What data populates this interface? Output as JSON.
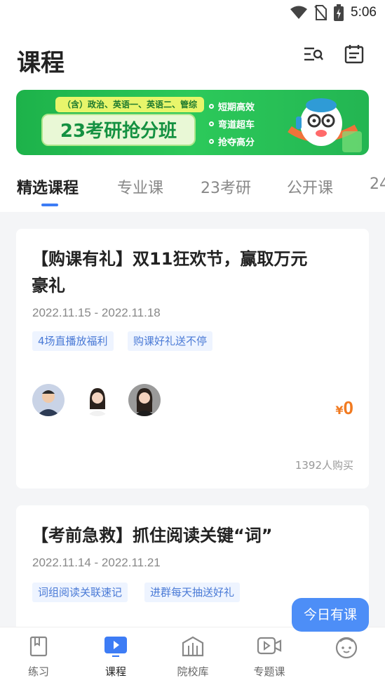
{
  "status_bar": {
    "time": "5:06"
  },
  "header": {
    "title": "课程"
  },
  "banner": {
    "subjects": "（含）政治、英语一、英语二、管综",
    "title": "23考研抢分班",
    "points": [
      "短期高效",
      "弯道超车",
      "抢夺高分"
    ]
  },
  "tabs": [
    {
      "label": "精选课程"
    },
    {
      "label": "专业课"
    },
    {
      "label": "23考研"
    },
    {
      "label": "公开课"
    },
    {
      "label": "24"
    }
  ],
  "courses": [
    {
      "title_line1": "【购课有礼】双11狂欢节，赢取万元",
      "title_line2": "豪礼",
      "date": "2022.11.15 - 2022.11.18",
      "tags": [
        "4场直播放福利",
        "购课好礼送不停"
      ],
      "price_symbol": "¥",
      "price": "0",
      "buyers": "1392人购买"
    },
    {
      "title_line1": "【考前急救】抓住阅读关键“词”",
      "date": "2022.11.14 - 2022.11.21",
      "tags": [
        "词组阅读关联速记",
        "进群每天抽送好礼"
      ]
    }
  ],
  "floating": {
    "today": "今日有课"
  },
  "bottom_nav": [
    {
      "label": "练习",
      "icon": "book-icon"
    },
    {
      "label": "课程",
      "icon": "play-icon"
    },
    {
      "label": "院校库",
      "icon": "building-icon"
    },
    {
      "label": "专题课",
      "icon": "video-icon"
    },
    {
      "label": "",
      "icon": "face-icon"
    }
  ],
  "colors": {
    "accent": "#3d7cf5",
    "price": "#f17a20",
    "banner_green": "#1db24a"
  }
}
